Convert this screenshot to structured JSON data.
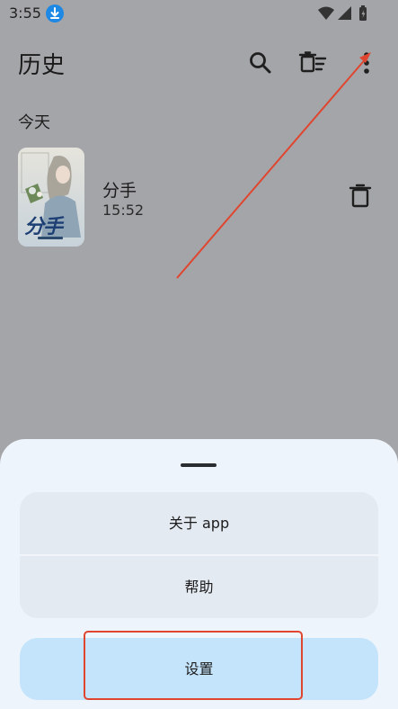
{
  "status_bar": {
    "time": "3:55"
  },
  "app_bar": {
    "title": "历史"
  },
  "history": {
    "section_label": "今天",
    "items": [
      {
        "title": "分手",
        "time": "15:52",
        "cover_text": "分手"
      }
    ]
  },
  "bottom_sheet": {
    "menu": [
      {
        "label": "关于 app"
      },
      {
        "label": "帮助"
      }
    ],
    "settings_label": "设置"
  },
  "colors": {
    "accent": "#1e88e5",
    "sheet_bg": "#eef4fb",
    "settings_bg": "#c4e4fb",
    "annotation": "#e0452f"
  }
}
